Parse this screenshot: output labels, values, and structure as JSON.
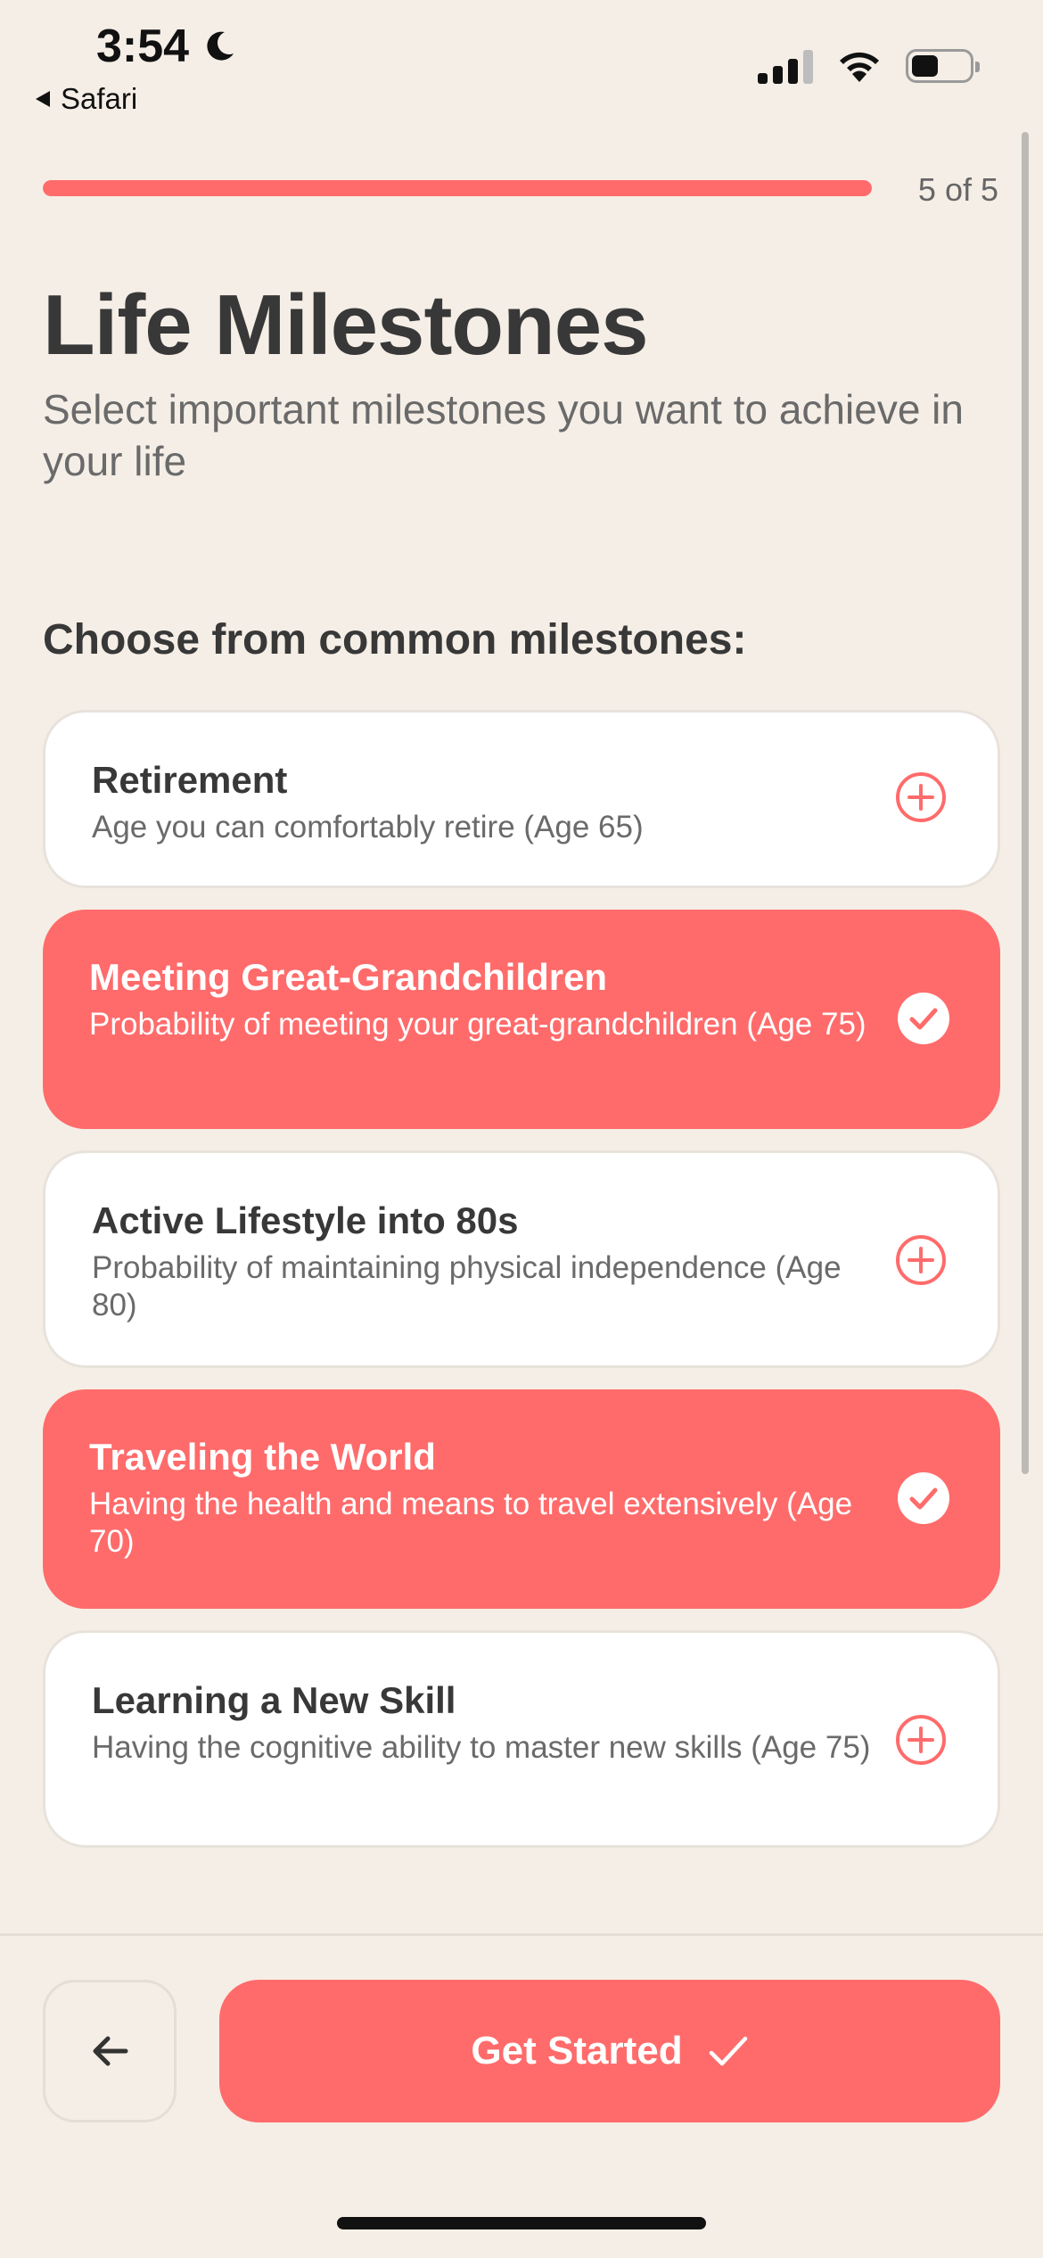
{
  "status_bar": {
    "time": "3:54",
    "back_app": "Safari",
    "icons": [
      "moon-icon",
      "cellular-signal-icon",
      "wifi-icon",
      "battery-icon"
    ]
  },
  "progress": {
    "label": "5 of 5",
    "fraction": 1.0
  },
  "header": {
    "title": "Life Milestones",
    "subtitle": "Select important milestones you want to achieve in your life"
  },
  "section": {
    "label": "Choose from common milestones:"
  },
  "milestones": [
    {
      "title": "Retirement",
      "description": "Age you can comfortably retire (Age 65)",
      "selected": false,
      "icon": "plus-circle-icon"
    },
    {
      "title": "Meeting Great-Grandchildren",
      "description": "Probability of meeting your great-grandchildren (Age 75)",
      "selected": true,
      "icon": "check-circle-icon"
    },
    {
      "title": "Active Lifestyle into 80s",
      "description": "Probability of maintaining physical independence (Age 80)",
      "selected": false,
      "icon": "plus-circle-icon"
    },
    {
      "title": "Traveling the World",
      "description": "Having the health and means to travel extensively (Age 70)",
      "selected": true,
      "icon": "check-circle-icon"
    },
    {
      "title": "Learning a New Skill",
      "description": "Having the cognitive ability to master new skills (Age 75)",
      "selected": false,
      "icon": "plus-circle-icon"
    }
  ],
  "footer": {
    "back_icon": "arrow-left-icon",
    "primary_label": "Get Started",
    "primary_icon": "checkmark-icon"
  },
  "colors": {
    "accent": "#FF6B6B",
    "background": "#F5EEE6",
    "text_dark": "#383838",
    "text_muted": "#6A6A6A"
  }
}
